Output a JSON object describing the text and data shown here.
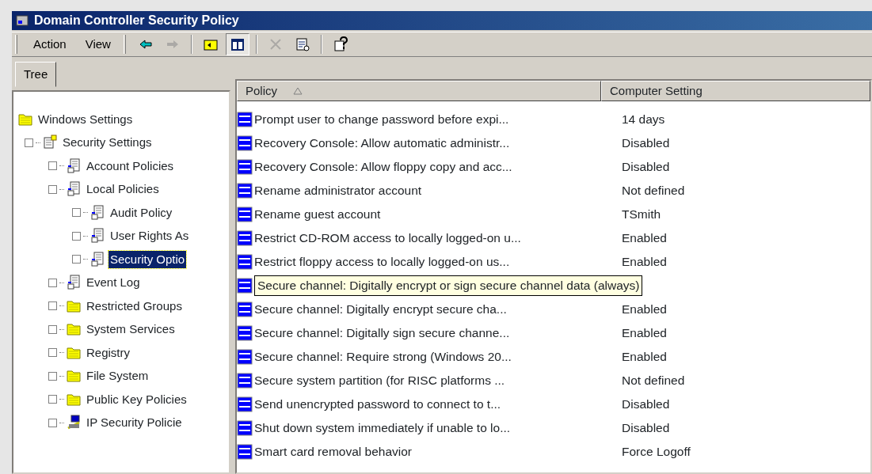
{
  "window": {
    "title": "Domain Controller Security Policy"
  },
  "menu": [
    "Action",
    "View"
  ],
  "toolbar": [
    {
      "kind": "back",
      "disabled": false
    },
    {
      "kind": "forward",
      "disabled": true
    },
    {
      "kind": "sep"
    },
    {
      "kind": "up-folder",
      "disabled": false
    },
    {
      "kind": "show-tree",
      "disabled": false,
      "pressed": true
    },
    {
      "kind": "sep"
    },
    {
      "kind": "delete",
      "disabled": true
    },
    {
      "kind": "export",
      "disabled": false
    },
    {
      "kind": "sep"
    },
    {
      "kind": "help",
      "disabled": false
    }
  ],
  "tabs": [
    {
      "label": "Tree",
      "selected": true
    }
  ],
  "tree": [
    {
      "label": "Windows Settings",
      "kind": "folder",
      "selected": false,
      "children": [
        {
          "label": "Security Settings",
          "kind": "security",
          "selected": false,
          "children": [
            {
              "label": "Account Policies",
              "kind": "policy",
              "selected": false
            },
            {
              "label": "Local Policies",
              "kind": "policy",
              "selected": false,
              "children": [
                {
                  "label": "Audit Policy",
                  "kind": "policy",
                  "selected": false
                },
                {
                  "label": "User Rights As",
                  "kind": "policy",
                  "selected": false
                },
                {
                  "label": "Security Optio",
                  "kind": "policy",
                  "selected": true
                }
              ]
            },
            {
              "label": "Event Log",
              "kind": "policy",
              "selected": false
            },
            {
              "label": "Restricted Groups",
              "kind": "folder",
              "selected": false
            },
            {
              "label": "System Services",
              "kind": "folder",
              "selected": false
            },
            {
              "label": "Registry",
              "kind": "folder",
              "selected": false
            },
            {
              "label": "File System",
              "kind": "folder",
              "selected": false
            },
            {
              "label": "Public Key Policies",
              "kind": "folder",
              "selected": false
            },
            {
              "label": "IP Security Policie",
              "kind": "network",
              "selected": false
            }
          ]
        }
      ]
    }
  ],
  "table": {
    "columns": [
      "Policy",
      "Computer Setting"
    ],
    "rows": [
      {
        "kind": "row",
        "name": "Prompt user to change password before expi...",
        "value": "14 days"
      },
      {
        "kind": "row",
        "name": "Recovery Console: Allow automatic administr...",
        "value": "Disabled"
      },
      {
        "kind": "row",
        "name": "Recovery Console: Allow floppy copy and acc...",
        "value": "Disabled"
      },
      {
        "kind": "row",
        "name": "Rename administrator account",
        "value": "Not defined"
      },
      {
        "kind": "row",
        "name": "Rename guest account",
        "value": "TSmith"
      },
      {
        "kind": "row",
        "name": "Restrict CD-ROM access to locally logged-on u...",
        "value": "Enabled"
      },
      {
        "kind": "row",
        "name": "Restrict floppy access to locally logged-on us...",
        "value": "Enabled"
      },
      {
        "kind": "tooltip",
        "name": "Secure channel: Digitally encrypt or sign secure channel data (always)"
      },
      {
        "kind": "row",
        "name": "Secure channel: Digitally encrypt secure cha...",
        "value": "Enabled"
      },
      {
        "kind": "row",
        "name": "Secure channel: Digitally sign secure channe...",
        "value": "Enabled"
      },
      {
        "kind": "row",
        "name": "Secure channel: Require strong (Windows 20...",
        "value": "Enabled"
      },
      {
        "kind": "row",
        "name": "Secure system partition (for RISC platforms ...",
        "value": "Not defined"
      },
      {
        "kind": "row",
        "name": "Send unencrypted password to connect to t...",
        "value": "Disabled"
      },
      {
        "kind": "row",
        "name": "Shut down system immediately if unable to lo...",
        "value": "Disabled"
      },
      {
        "kind": "row",
        "name": "Smart card removal behavior",
        "value": "Force Logoff"
      }
    ]
  }
}
